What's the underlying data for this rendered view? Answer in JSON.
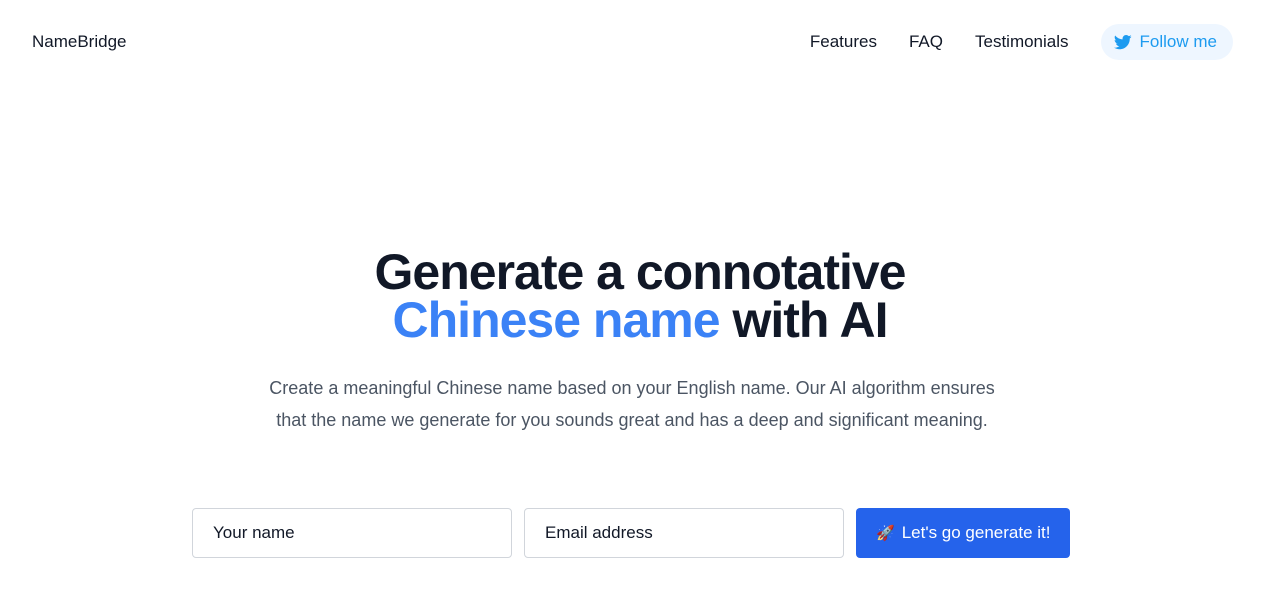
{
  "header": {
    "logo": "NameBridge",
    "nav": [
      {
        "label": "Features"
      },
      {
        "label": "FAQ"
      },
      {
        "label": "Testimonials"
      }
    ],
    "follow_button": {
      "label": "Follow me",
      "icon": "twitter-icon"
    }
  },
  "hero": {
    "headline_line1": "Generate a connotative",
    "headline_accent": "Chinese name",
    "headline_rest": "with AI",
    "description": "Create a meaningful Chinese name based on your English name. Our AI algorithm ensures that the name we generate for you sounds great and has a deep and significant meaning."
  },
  "form": {
    "name_placeholder": "Your name",
    "email_placeholder": "Email address",
    "submit_icon": "🚀",
    "submit_label": "Let's go generate it!"
  },
  "colors": {
    "accent": "#3b82f6",
    "button": "#2563eb",
    "twitter": "#1d9bf0",
    "follow_bg": "#eef6ff"
  }
}
